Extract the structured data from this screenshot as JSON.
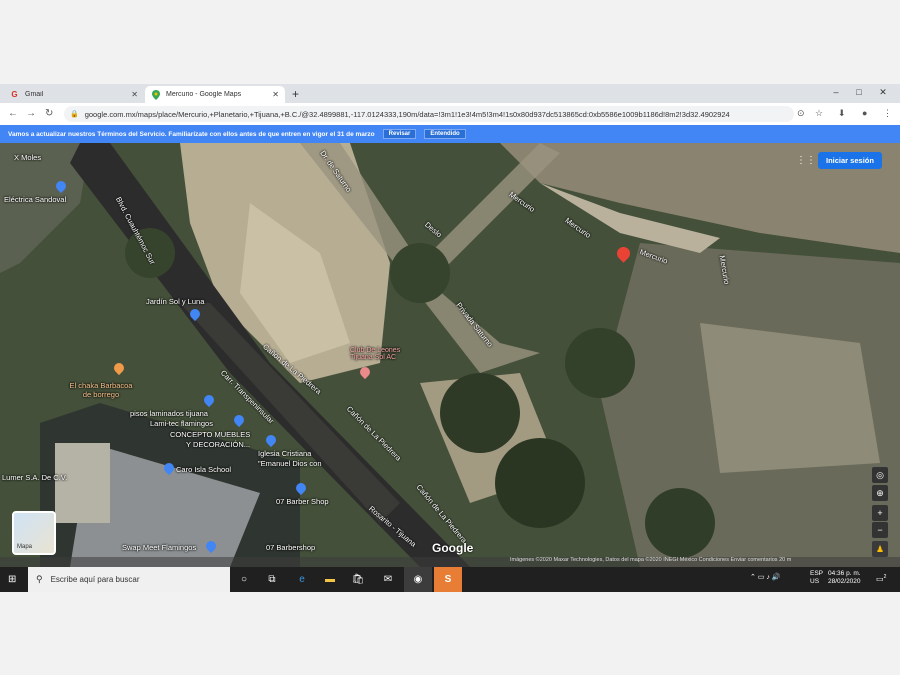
{
  "tabs": [
    {
      "title": "Gmail",
      "favicon": "G",
      "active": false
    },
    {
      "title": "Mercurio - Google Maps",
      "favicon": "map-pin-icon",
      "active": true
    }
  ],
  "new_tab_label": "+",
  "window_controls": {
    "minimize": "–",
    "maximize": "□",
    "close": "✕"
  },
  "address": "google.com.mx/maps/place/Mercurio,+Planetario,+Tijuana,+B.C./@32.4899881,-117.0124333,190m/data=!3m1!1e3!4m5!3m4!1s0x80d937dc513865cd:0xb5586e1009b1186d!8m2!3d32.4902924",
  "infobar": {
    "message": "Vamos a actualizar nuestros Términos del Servicio. Familiarízate con ellos antes de que entren en vigor el 31 de marzo",
    "review": "Revisar",
    "understood": "Entendido"
  },
  "map": {
    "sign_in": "Iniciar sesión",
    "layers_label": "Mapa",
    "logo": "Google",
    "attribution": "Imágenes ©2020 Maxar Technologies, Datos del mapa ©2020 INEGI   México   Condiciones   Enviar comentarios   20 m",
    "streets": [
      {
        "name": "Blvd. Cuauhtémoc Sur"
      },
      {
        "name": "Dr. de Saturno"
      },
      {
        "name": "Mercurio"
      },
      {
        "name": "Mercurio"
      },
      {
        "name": "Mercurio"
      },
      {
        "name": "Mercurio"
      },
      {
        "name": "Privada Saturno"
      },
      {
        "name": "Cañón de La Piedrera"
      },
      {
        "name": "Cañón de La Piedrera"
      },
      {
        "name": "Cañón de La Piedrera"
      },
      {
        "name": "Carr. Transpeninsular"
      },
      {
        "name": "Rosarito - Tijuana"
      },
      {
        "name": "Deslo"
      }
    ],
    "places": [
      {
        "name": "X Moles"
      },
      {
        "name": "Eléctrica Sandoval"
      },
      {
        "name": "Jardín Sol y Luna"
      },
      {
        "name": "Club De Leones Tijuana Sol AC"
      },
      {
        "name": "El chaka Barbacoa de borrego"
      },
      {
        "name": "pisos laminados tijuana"
      },
      {
        "name": "Lami-tec flamingos"
      },
      {
        "name": "CONCEPTO MUEBLES"
      },
      {
        "name": "Y DECORACIÓN..."
      },
      {
        "name": "Iglesia Cristiana"
      },
      {
        "name": "\"Emanuel Dios con"
      },
      {
        "name": "Caro Isla School"
      },
      {
        "name": "07 Barber Shop"
      },
      {
        "name": "07 Barbershop"
      },
      {
        "name": "Swap Meet Flamingos"
      },
      {
        "name": "Lumer S.A. De C.V."
      }
    ],
    "zoom_in": "+",
    "zoom_out": "−"
  },
  "taskbar": {
    "search_placeholder": "Escribe aquí para buscar",
    "lang_top": "ESP",
    "lang_bottom": "US",
    "time": "04:36 p. m.",
    "date": "28/02/2020",
    "notifications": "2"
  },
  "colors": {
    "accent": "#4285f4",
    "pin": "#ea4335",
    "taskbar": "#202020"
  }
}
